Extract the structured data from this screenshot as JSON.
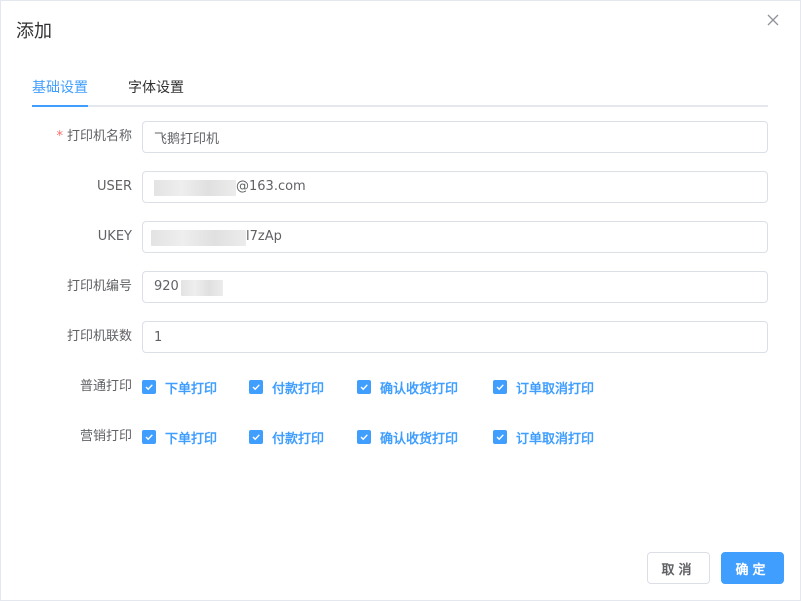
{
  "dialog": {
    "title": "添加"
  },
  "tabs": [
    {
      "label": "基础设置",
      "active": true
    },
    {
      "label": "字体设置",
      "active": false
    }
  ],
  "form": {
    "printer_name": {
      "label": "打印机名称",
      "required_mark": "*",
      "value": "飞鹅打印机"
    },
    "user": {
      "label": "USER",
      "value_visible": "@163.com"
    },
    "ukey": {
      "label": "UKEY",
      "value_visible": "l7zAp"
    },
    "printer_sn": {
      "label": "打印机编号",
      "value_visible": "920"
    },
    "copies": {
      "label": "打印机联数",
      "value": "1"
    },
    "normal_print": {
      "label": "普通打印",
      "options": [
        {
          "label": "下单打印",
          "checked": true
        },
        {
          "label": "付款打印",
          "checked": true
        },
        {
          "label": "确认收货打印",
          "checked": true
        },
        {
          "label": "订单取消打印",
          "checked": true
        }
      ]
    },
    "marketing_print": {
      "label": "营销打印",
      "options": [
        {
          "label": "下单打印",
          "checked": true
        },
        {
          "label": "付款打印",
          "checked": true
        },
        {
          "label": "确认收货打印",
          "checked": true
        },
        {
          "label": "订单取消打印",
          "checked": true
        }
      ]
    }
  },
  "footer": {
    "cancel_label": "取消",
    "ok_label": "确定"
  },
  "colors": {
    "primary": "#409eff",
    "required": "#f56c6c",
    "border": "#dcdfe6",
    "text": "#606266"
  }
}
